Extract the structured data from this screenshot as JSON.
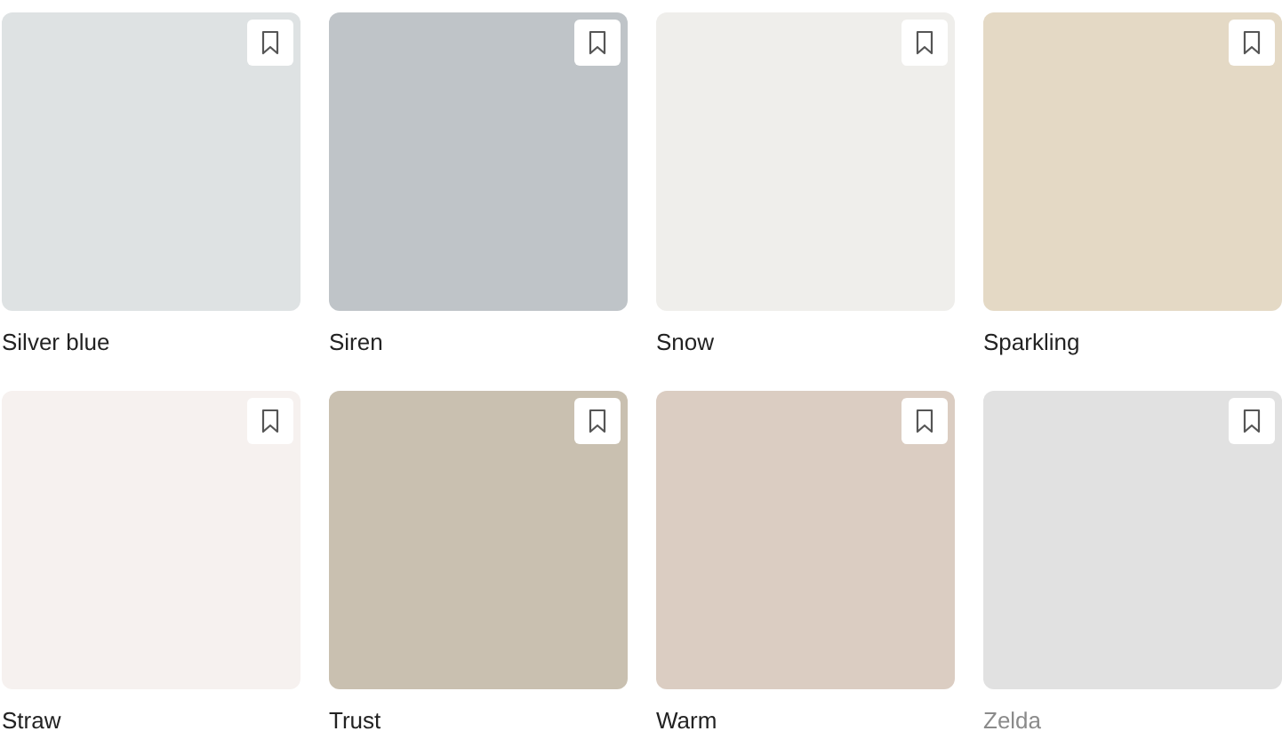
{
  "swatches": [
    {
      "name": "Silver blue",
      "color": "#dee2e3",
      "muted": false
    },
    {
      "name": "Siren",
      "color": "#bfc4c8",
      "muted": false
    },
    {
      "name": "Snow",
      "color": "#efeeeb",
      "muted": false
    },
    {
      "name": "Sparkling",
      "color": "#e4d9c5",
      "muted": false
    },
    {
      "name": "Straw",
      "color": "#f6f1ef",
      "muted": false
    },
    {
      "name": "Trust",
      "color": "#c9c0b0",
      "muted": false
    },
    {
      "name": "Warm",
      "color": "#dbcdc2",
      "muted": false
    },
    {
      "name": "Zelda",
      "color": "#e1e1e1",
      "muted": true
    }
  ]
}
